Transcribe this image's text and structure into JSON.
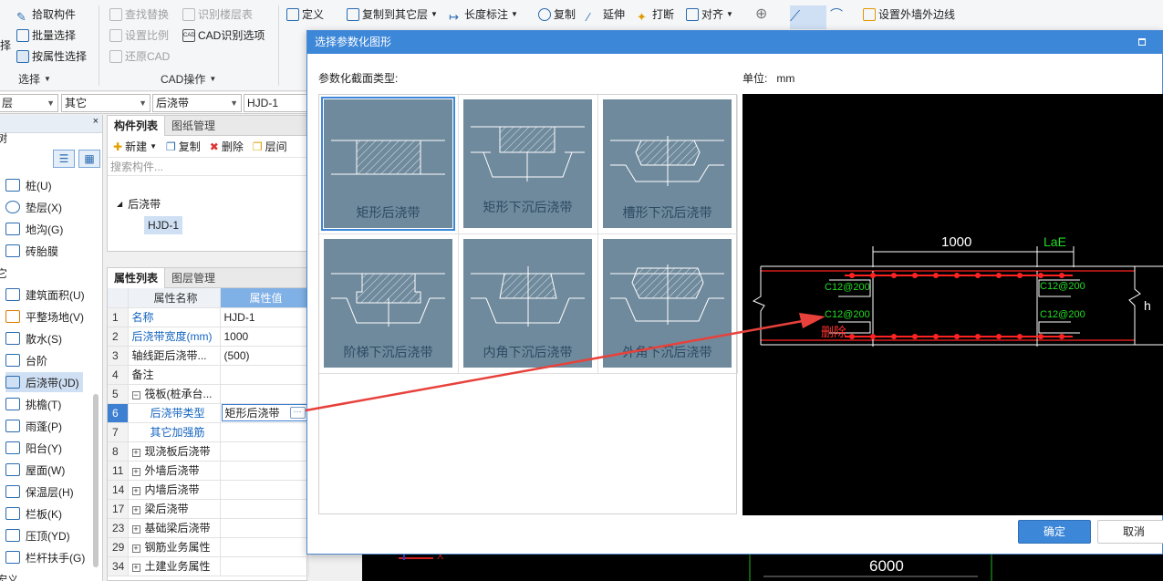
{
  "ribbon": {
    "select": {
      "pick": "拾取构件",
      "batch": "批量选择",
      "byprop": "按属性选择",
      "select_partial": "择",
      "group": "选择"
    },
    "cad": {
      "find_replace": "查找替换",
      "identify_floor": "识别楼层表",
      "set_scale": "设置比例",
      "cad_options": "CAD识别选项",
      "restore_cad": "还原CAD",
      "group": "CAD操作"
    },
    "edit": {
      "define": "定义",
      "copy_to_floor": "复制到其它层",
      "length_dim": "长度标注",
      "copy": "复制",
      "extend": "延伸",
      "break": "打断",
      "align": "对齐",
      "set_outer_wall": "设置外墙外边线"
    }
  },
  "filterbar": {
    "floor": "层",
    "type": "其它",
    "category": "后浇带",
    "item": "HJD-1"
  },
  "left_tree": {
    "header": "树",
    "other_group": "它",
    "bottom_partial": "宏义",
    "items": [
      {
        "label": "桩(U)"
      },
      {
        "label": "垫层(X)"
      },
      {
        "label": "地沟(G)"
      },
      {
        "label": "砖胎膜"
      },
      {
        "label": "建筑面积(U)"
      },
      {
        "label": "平整场地(V)"
      },
      {
        "label": "散水(S)"
      },
      {
        "label": "台阶"
      },
      {
        "label": "后浇带(JD)"
      },
      {
        "label": "挑檐(T)"
      },
      {
        "label": "雨蓬(P)"
      },
      {
        "label": "阳台(Y)"
      },
      {
        "label": "屋面(W)"
      },
      {
        "label": "保温层(H)"
      },
      {
        "label": "栏板(K)"
      },
      {
        "label": "压顶(YD)"
      },
      {
        "label": "栏杆扶手(G)"
      }
    ]
  },
  "complist": {
    "tab_list": "构件列表",
    "tab_drawing": "图纸管理",
    "new": "新建",
    "copy": "复制",
    "delete": "删除",
    "floor_partial": "层间",
    "search_placeholder": "搜索构件...",
    "group": "后浇带",
    "item": "HJD-1"
  },
  "props": {
    "tab_props": "属性列表",
    "tab_layers": "图层管理",
    "col_name": "属性名称",
    "col_value": "属性值",
    "rows": [
      {
        "no": "1",
        "name": "名称",
        "value": "HJD-1"
      },
      {
        "no": "2",
        "name": "后浇带宽度(mm)",
        "value": "1000"
      },
      {
        "no": "3",
        "name": "轴线距后浇带...",
        "value": "(500)"
      },
      {
        "no": "4",
        "name": "备注",
        "value": ""
      },
      {
        "no": "5",
        "name": "筏板(桩承台...",
        "value": ""
      },
      {
        "no": "6",
        "name": "后浇带类型",
        "value": "矩形后浇带"
      },
      {
        "no": "7",
        "name": "其它加强筋",
        "value": ""
      },
      {
        "no": "8",
        "name": "现浇板后浇带",
        "value": ""
      },
      {
        "no": "11",
        "name": "外墙后浇带",
        "value": ""
      },
      {
        "no": "14",
        "name": "内墙后浇带",
        "value": ""
      },
      {
        "no": "17",
        "name": "梁后浇带",
        "value": ""
      },
      {
        "no": "23",
        "name": "基础梁后浇带",
        "value": ""
      },
      {
        "no": "29",
        "name": "钢筋业务属性",
        "value": ""
      },
      {
        "no": "34",
        "name": "土建业务属性",
        "value": ""
      }
    ]
  },
  "dialog": {
    "title": "选择参数化图形",
    "type_label": "参数化截面类型:",
    "unit_label": "单位:",
    "unit_value": "mm",
    "shapes": [
      {
        "label": "矩形后浇带"
      },
      {
        "label": "矩形下沉后浇带"
      },
      {
        "label": "槽形下沉后浇带"
      },
      {
        "label": "阶梯下沉后浇带"
      },
      {
        "label": "内角下沉后浇带"
      },
      {
        "label": "外角下沉后浇带"
      }
    ],
    "preview": {
      "width_dim": "1000",
      "lae": "LaE",
      "rebar_tl": "C12@200",
      "rebar_tr": "C12@200",
      "rebar_bl": "C12@200",
      "rebar_br": "C12@200",
      "h": "h",
      "annotation": "删除"
    },
    "ok": "确定",
    "cancel": "取消"
  },
  "canvas": {
    "dim_6000": "6000",
    "axis_x": "X"
  },
  "colors": {
    "accent": "#3d87d8",
    "thumb_bg": "#6f8a9d",
    "rebar_green": "#22dd22",
    "rebar_red": "#ff2222",
    "arrow_red": "#e8413b"
  }
}
